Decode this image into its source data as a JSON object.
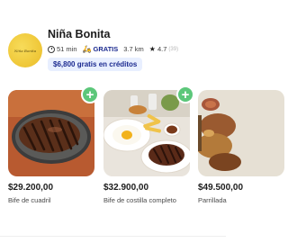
{
  "store": {
    "logo_text": "Niña Bonita",
    "name": "Niña Bonita",
    "delivery_time": "51 min",
    "shipping": "GRATIS",
    "distance": "3.7 km",
    "rating": "4.7",
    "reviews": "(39)",
    "credits_badge": "$6,800 gratis en créditos"
  },
  "products": [
    {
      "price": "$29.200,00",
      "name": "Bife de cuadril"
    },
    {
      "price": "$32.900,00",
      "name": "Bife de costilla completo"
    },
    {
      "price": "$49.500,00",
      "name": "Parrillada"
    }
  ],
  "colors": {
    "accent_blue": "#1b2a8f",
    "badge_bg": "#e8efff",
    "add_green": "#5cc77a"
  }
}
